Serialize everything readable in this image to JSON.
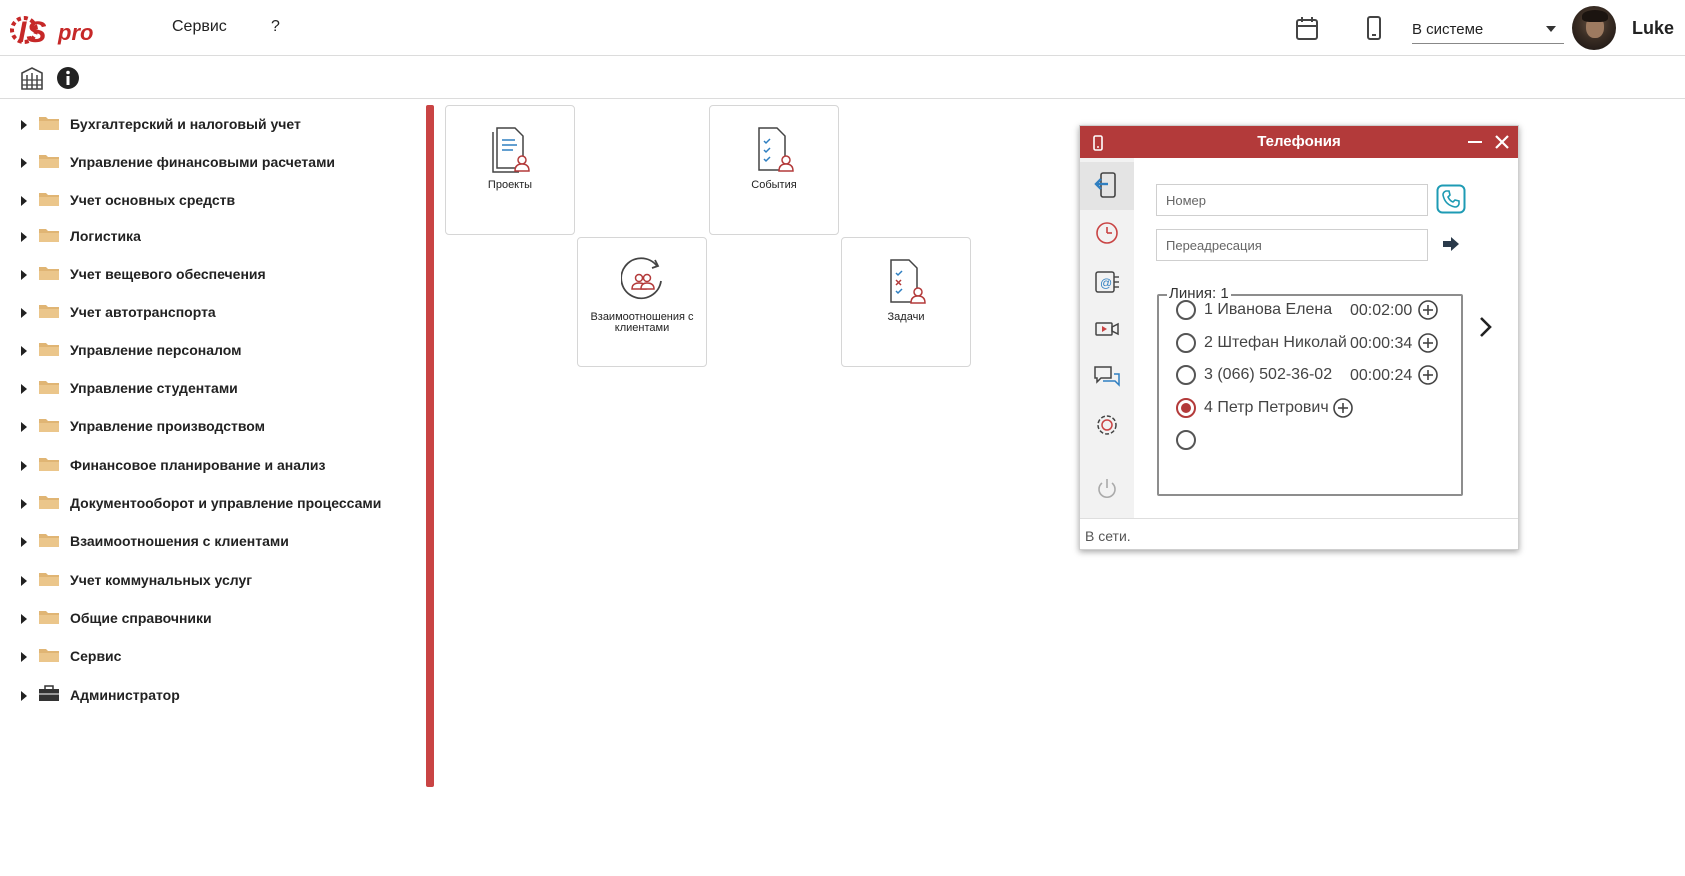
{
  "header": {
    "logo_text": "ISpro",
    "menu": [
      {
        "label": "Сервис"
      },
      {
        "label": "?"
      }
    ],
    "calendar_icon": "calendar-icon",
    "phone_icon": "mobile-phone-icon",
    "status": {
      "value": "В системе"
    },
    "user": {
      "name": "Luke"
    }
  },
  "toolbar": {
    "icons": [
      "organization-icon",
      "info-icon"
    ]
  },
  "sidebar": {
    "items": [
      {
        "label": "Бухгалтерский и налоговый учет",
        "icon": "folder-icon"
      },
      {
        "label": "Управление финансовыми расчетами",
        "icon": "folder-icon"
      },
      {
        "label": "Учет основных средств",
        "icon": "folder-icon"
      },
      {
        "label": "Логистика",
        "icon": "folder-icon"
      },
      {
        "label": "Учет вещевого обеспечения",
        "icon": "folder-icon"
      },
      {
        "label": "Учет автотранспорта",
        "icon": "folder-icon"
      },
      {
        "label": "Управление персоналом",
        "icon": "folder-icon"
      },
      {
        "label": "Управление студентами",
        "icon": "folder-icon"
      },
      {
        "label": "Управление производством",
        "icon": "folder-icon"
      },
      {
        "label": "Финансовое планирование и анализ",
        "icon": "folder-icon"
      },
      {
        "label": "Документооборот и управление процессами",
        "icon": "folder-icon"
      },
      {
        "label": "Взаимоотношения с клиентами",
        "icon": "folder-icon"
      },
      {
        "label": "Учет коммунальных услуг",
        "icon": "folder-icon"
      },
      {
        "label": "Общие справочники",
        "icon": "folder-icon"
      },
      {
        "label": "Сервис",
        "icon": "folder-icon"
      },
      {
        "label": "Администратор",
        "icon": "briefcase-icon"
      }
    ]
  },
  "tiles": [
    {
      "label": "Проекты",
      "icon": "projects-document-icon"
    },
    {
      "label": "События",
      "icon": "events-checklist-icon"
    },
    {
      "label": "Взаимоотношения с клиентами",
      "icon": "client-relations-icon"
    },
    {
      "label": "Задачи",
      "icon": "tasks-checklist-icon"
    }
  ],
  "telephony": {
    "title": "Телефония",
    "number_placeholder": "Номер",
    "forward_placeholder": "Переадресация",
    "line_legend": "Линия: 1",
    "lines": [
      {
        "name": "1 Иванова Елена",
        "time": "00:02:00",
        "selected": false
      },
      {
        "name": "2 Штефан Николай",
        "time": "00:00:34",
        "selected": false
      },
      {
        "name": "3 (066) 502-36-02",
        "time": "00:00:24",
        "selected": false
      },
      {
        "name": "4 Петр Петрович",
        "time": "",
        "selected": true
      },
      {
        "name": "",
        "time": "",
        "selected": false
      }
    ],
    "status_text": "В сети.",
    "accent_color": "#b33a3a"
  }
}
